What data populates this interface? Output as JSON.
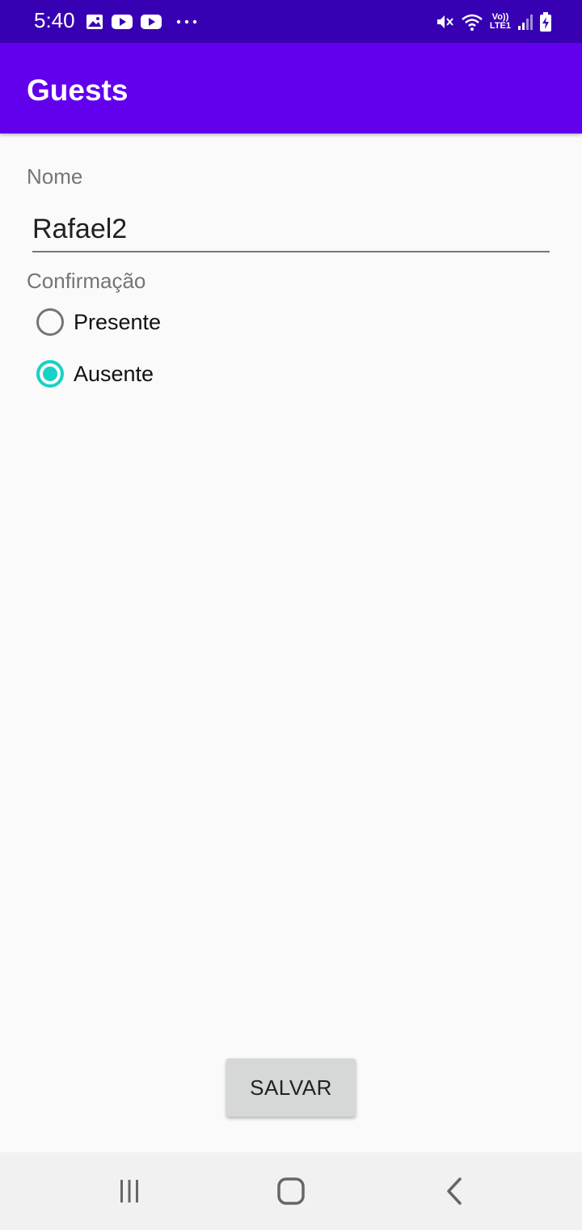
{
  "status_bar": {
    "time": "5:40",
    "network_label_top": "Vo))",
    "network_label_bottom": "LTE1",
    "icons": [
      "image-icon",
      "youtube-icon",
      "youtube-icon",
      "more-dots-icon",
      "mute-icon",
      "wifi-icon",
      "lte-icon",
      "signal-icon",
      "battery-charging-icon"
    ]
  },
  "app_bar": {
    "title": "Guests",
    "color": "#6200ee"
  },
  "form": {
    "name_label": "Nome",
    "name_value": "Rafael2",
    "confirmation_label": "Confirmação",
    "options": [
      {
        "label": "Presente",
        "checked": false
      },
      {
        "label": "Ausente",
        "checked": true
      }
    ],
    "accent_color": "#18d1c5"
  },
  "save_button": {
    "label": "SALVAR"
  },
  "nav_bar": {
    "icons": [
      "recent-apps-icon",
      "home-icon",
      "back-icon"
    ]
  }
}
